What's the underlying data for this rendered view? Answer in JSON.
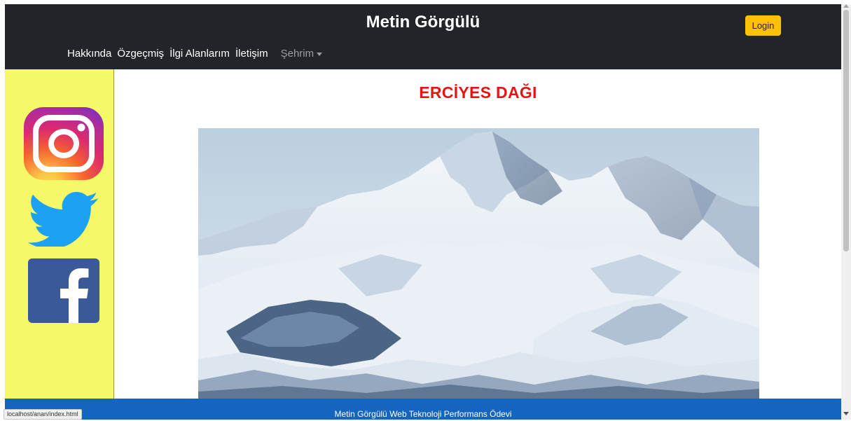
{
  "header": {
    "brand": "Metin Görgülü",
    "login_label": "Login",
    "nav": [
      "Hakkında",
      "Özgeçmiş",
      "İlgi Alanlarım",
      "İletişim"
    ],
    "dropdown_label": "Şehrim",
    "bg_color": "#212529",
    "login_color": "#ffc107"
  },
  "sidebar": {
    "bg_color": "#f5f867",
    "icons": [
      "instagram-icon",
      "twitter-icon",
      "facebook-icon"
    ]
  },
  "main": {
    "title": "ERCİYES DAĞI",
    "title_color": "#e61515",
    "image": "snowy-mountain-photo"
  },
  "footer": {
    "text": "Metin Görgülü Web Teknoloji Performans Ödevi",
    "bg_color": "#1565c0"
  },
  "status": {
    "url": "localhost/anan/index.html"
  }
}
